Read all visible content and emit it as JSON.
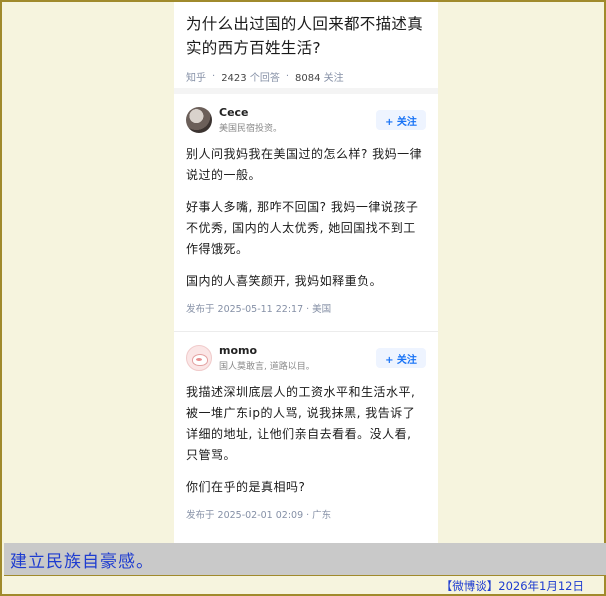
{
  "question": {
    "title": "为什么出过国的人回来都不描述真实的西方百姓生活?",
    "source": "知乎",
    "answers_count": "2423",
    "answers_label": "个回答",
    "followers_count": "8084",
    "followers_label": "关注"
  },
  "answers": [
    {
      "author": "Cece",
      "bio": "美国民宿投资。",
      "follow_label": "+ 关注",
      "paragraphs": [
        "别人问我妈我在美国过的怎么样? 我妈一律说过的一般。",
        "好事人多嘴, 那咋不回国? 我妈一律说孩子不优秀, 国内的人太优秀, 她回国找不到工作得饿死。",
        "国内的人喜笑颜开, 我妈如释重负。"
      ],
      "posted": "发布于  2025-05-11  22:17 · 美国"
    },
    {
      "author": "momo",
      "bio": "国人莫敢言, 道路以目。",
      "follow_label": "+ 关注",
      "paragraphs": [
        "我描述深圳底层人的工资水平和生活水平, 被一堆广东ip的人骂, 说我抹黑, 我告诉了详细的地址, 让他们亲自去看看。没人看, 只管骂。",
        "你们在乎的是真相吗?"
      ],
      "posted": "发布于  2025-02-01  02:09 · 广东"
    }
  ],
  "caption": "建立民族自豪感。",
  "footer": "【微博谈】2026年1月12日"
}
